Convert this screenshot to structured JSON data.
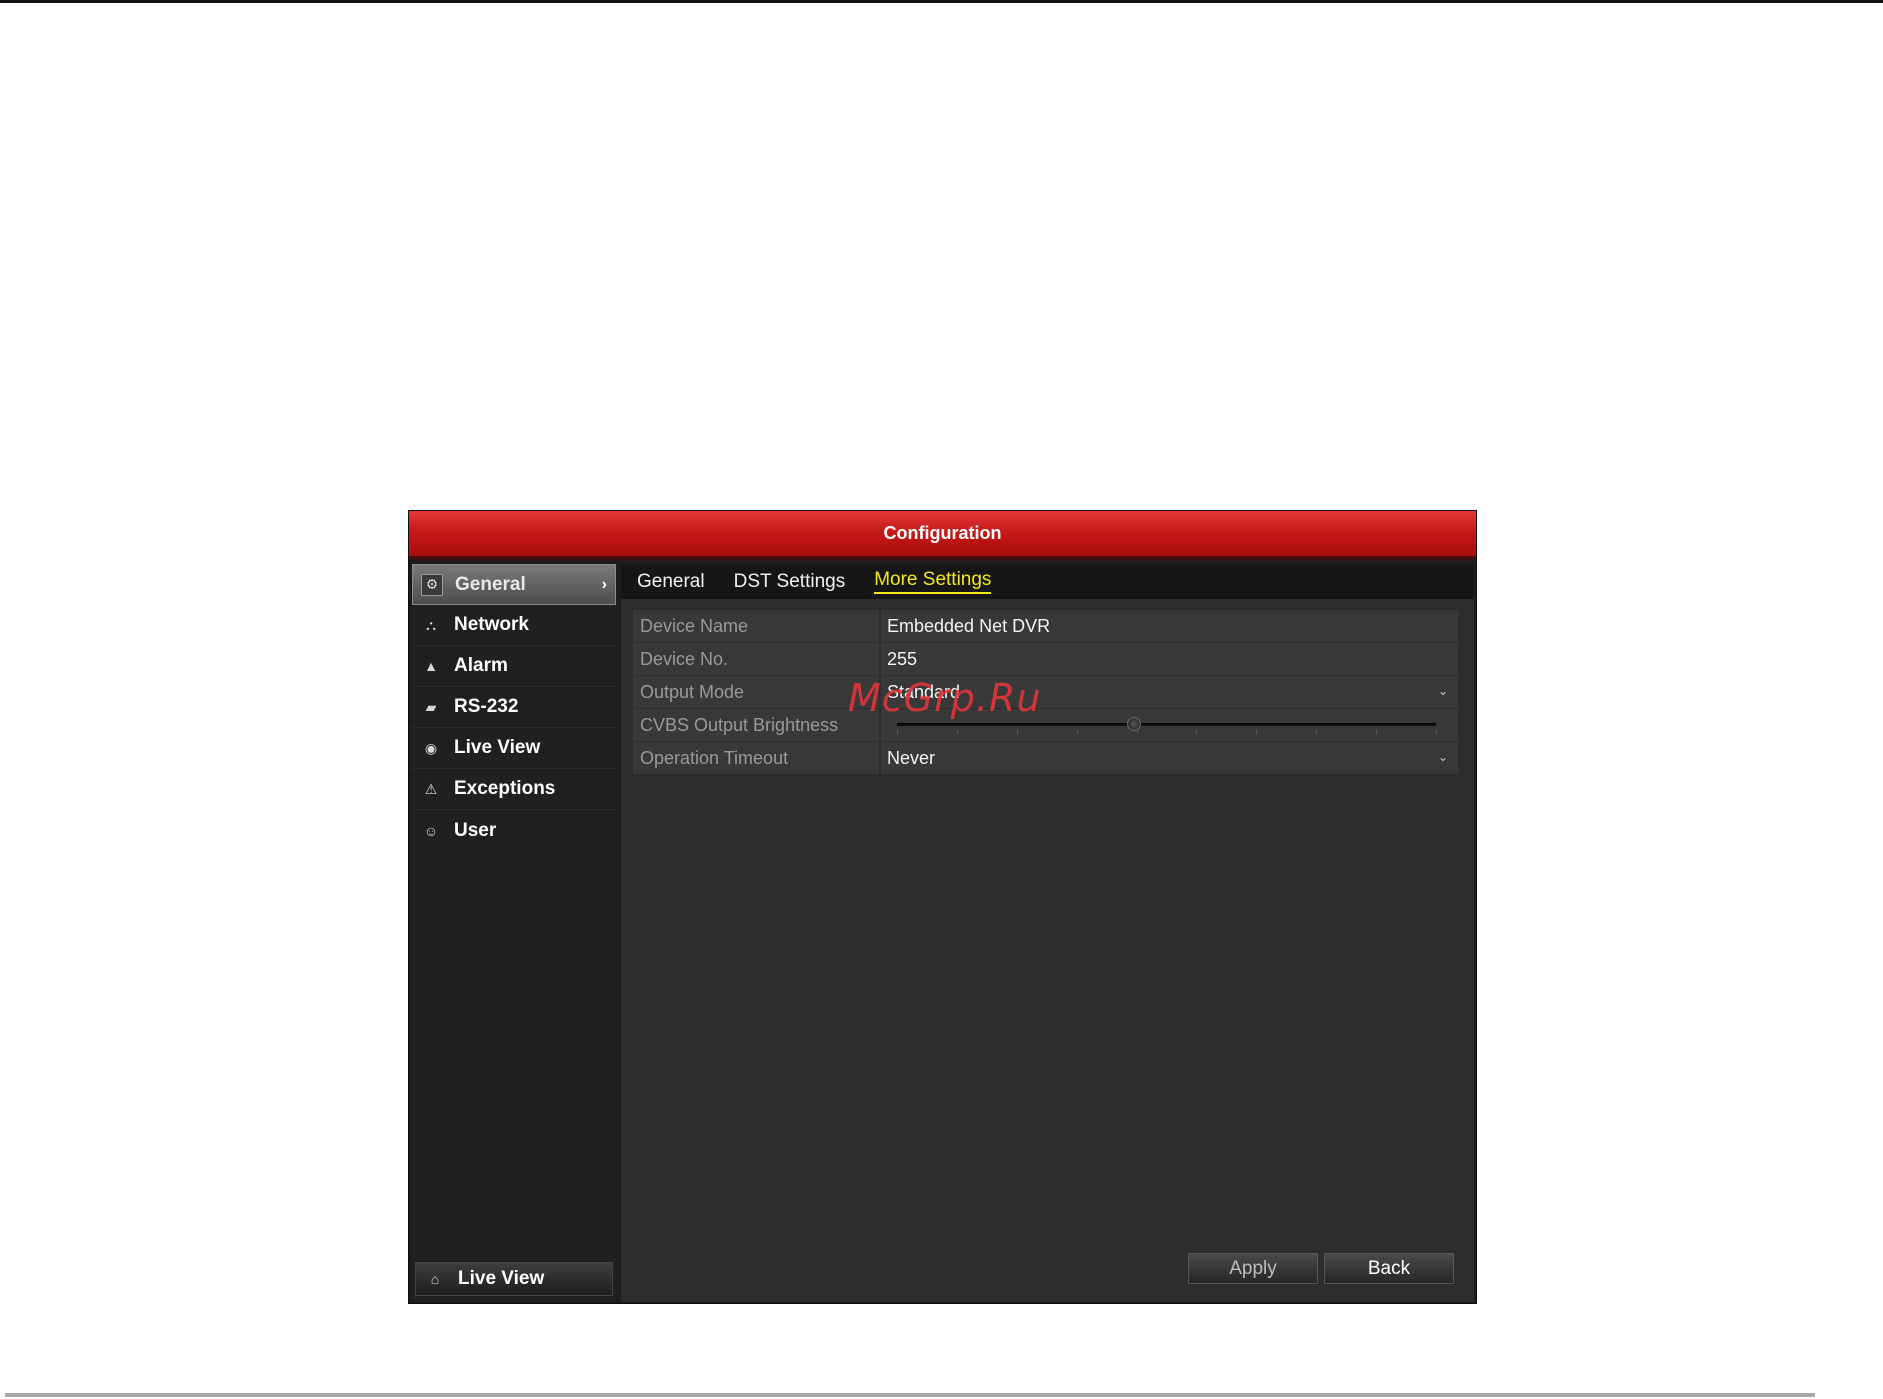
{
  "window": {
    "title": "Configuration"
  },
  "sidebar": {
    "items": [
      {
        "label": "General",
        "icon": "gear-icon",
        "active": true
      },
      {
        "label": "Network",
        "icon": "network-icon"
      },
      {
        "label": "Alarm",
        "icon": "bell-icon"
      },
      {
        "label": "RS-232",
        "icon": "serial-port-icon"
      },
      {
        "label": "Live View",
        "icon": "eye-icon"
      },
      {
        "label": "Exceptions",
        "icon": "warning-icon"
      },
      {
        "label": "User",
        "icon": "users-icon"
      }
    ],
    "footer": {
      "label": "Live View",
      "icon": "home-icon"
    }
  },
  "tabs": [
    {
      "label": "General"
    },
    {
      "label": "DST Settings"
    },
    {
      "label": "More Settings",
      "active": true
    }
  ],
  "form": {
    "device_name": {
      "label": "Device Name",
      "value": "Embedded Net DVR"
    },
    "device_no": {
      "label": "Device No.",
      "value": "255"
    },
    "output_mode": {
      "label": "Output Mode",
      "value": "Standard"
    },
    "cvbs_brightness": {
      "label": "CVBS Output Brightness",
      "level": 0.44
    },
    "operation_timeout": {
      "label": "Operation Timeout",
      "value": "Never"
    }
  },
  "buttons": {
    "apply": "Apply",
    "back": "Back"
  },
  "watermark": "McGrp.Ru",
  "colors": {
    "title_red": "#c21515",
    "active_tab": "#f2ea1a",
    "watermark": "#e2353b"
  }
}
